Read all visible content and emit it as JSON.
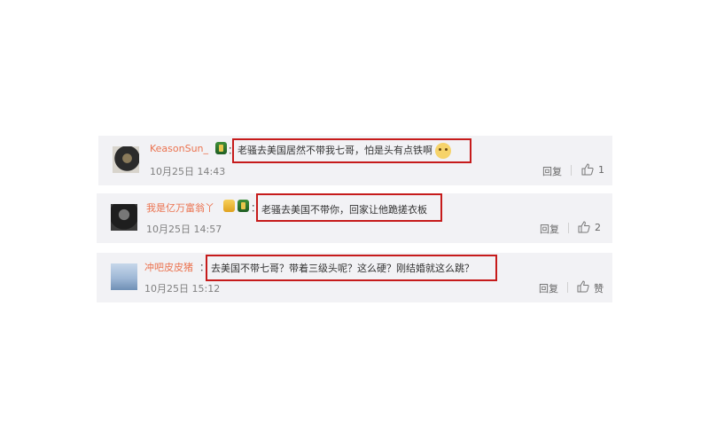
{
  "comments": [
    {
      "author": "KeasonSun_",
      "colon": "：",
      "text": "老骚去美国居然不带我七哥，怕是头有点铁啊",
      "time": "10月25日 14:43",
      "reply": "回复",
      "likes": "1",
      "badges": [
        "level-icon"
      ],
      "emoji": "dog-face-emoji"
    },
    {
      "author": "我是亿万富翁丫",
      "colon": "：",
      "text": "老骚去美国不带你，回家让他跪搓衣板",
      "time": "10月25日 14:57",
      "reply": "回复",
      "likes": "2",
      "badges": [
        "vip-icon",
        "level-icon"
      ]
    },
    {
      "author": "冲吧皮皮猪",
      "colon": "：",
      "text": "去美国不带七哥？带着三级头呢？这么硬？刚结婚就这么跳？",
      "time": "10月25日 15:12",
      "reply": "回复",
      "likes": "赞",
      "badges": []
    }
  ],
  "colors": {
    "author": "#eb7350",
    "highlight_border": "#c61b1b",
    "row_bg": "#f2f2f5"
  }
}
